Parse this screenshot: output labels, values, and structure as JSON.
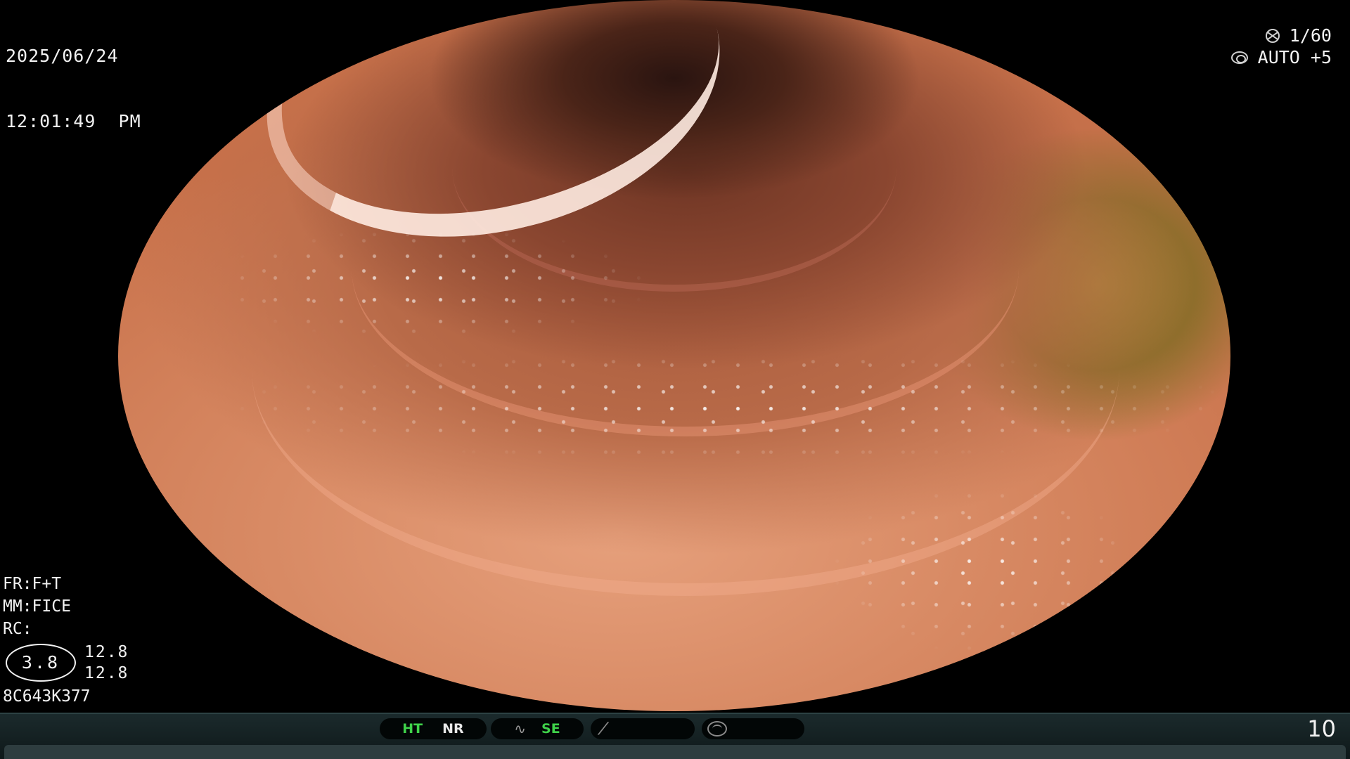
{
  "header": {
    "date": "2025/06/24",
    "time": "12:01:49  PM"
  },
  "top_right": {
    "shutter_value": "1/60",
    "iris_value": "AUTO +5",
    "shutter_icon": "shutter-icon",
    "iris_icon": "iris-icon"
  },
  "settings": {
    "fr": "FR:F+T",
    "mm": "MM:FICE",
    "rc": "RC:",
    "zoom_value": "3.8",
    "value_a": "12.8",
    "value_b": "12.8",
    "serial": "8C643K377"
  },
  "status_bar": {
    "ht_label": "HT",
    "nr_label": "NR",
    "se_label": "SE",
    "frame_number": "10",
    "colors": {
      "active_green": "#3fd24a",
      "text_white": "#e8e8e8",
      "bar_bg": "#1b2a2c"
    }
  },
  "scope": {
    "view": "endoscopic-view",
    "colors": {
      "mucosa": "#d88a64",
      "lumen": "#2a1410",
      "residue": "#a58436"
    }
  }
}
